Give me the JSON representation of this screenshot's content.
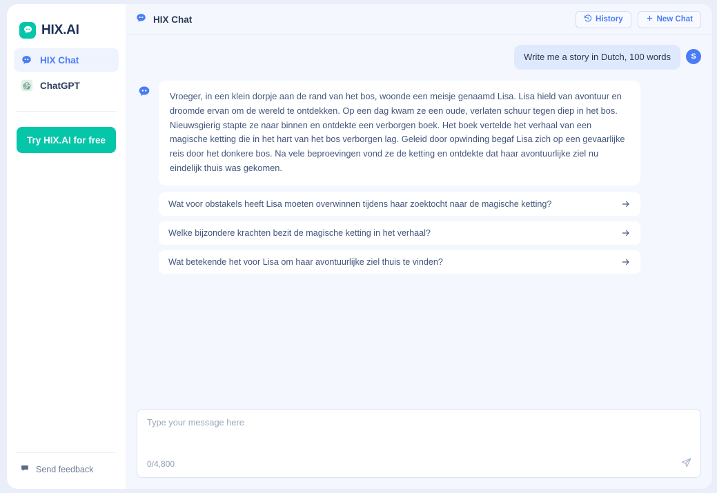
{
  "sidebar": {
    "brand": {
      "name": "HIX.AI",
      "icon": "hix-logo-icon",
      "color": "#05c6a9"
    },
    "items": [
      {
        "label": "HIX Chat",
        "icon": "hix-chat-icon",
        "active": true
      },
      {
        "label": "ChatGPT",
        "icon": "openai-icon",
        "active": false
      }
    ],
    "cta_label": "Try HIX.AI for free",
    "footer": {
      "label": "Send feedback",
      "icon": "feedback-flag-icon"
    }
  },
  "header": {
    "title": "HIX Chat",
    "icon": "hix-chat-icon",
    "history_label": "History",
    "history_icon": "clock-history-icon",
    "new_chat_label": "New Chat",
    "new_chat_icon": "plus-icon"
  },
  "conversation": {
    "user_message": "Write me a story in Dutch, 100 words",
    "user_avatar_initial": "S",
    "assistant_message": "Vroeger, in een klein dorpje aan de rand van het bos, woonde een meisje genaamd Lisa. Lisa hield van avontuur en droomde ervan om de wereld te ontdekken. Op een dag kwam ze een oude, verlaten schuur tegen diep in het bos. Nieuwsgierig stapte ze naar binnen en ontdekte een verborgen boek. Het boek vertelde het verhaal van een magische ketting die in het hart van het bos verborgen lag. Geleid door opwinding begaf Lisa zich op een gevaarlijke reis door het donkere bos. Na vele beproevingen vond ze de ketting en ontdekte dat haar avontuurlijke ziel nu eindelijk thuis was gekomen.",
    "suggestions": [
      "Wat voor obstakels heeft Lisa moeten overwinnen tijdens haar zoektocht naar de magische ketting?",
      "Welke bijzondere krachten bezit de magische ketting in het verhaal?",
      "Wat betekende het voor Lisa om haar avontuurlijke ziel thuis te vinden?"
    ]
  },
  "composer": {
    "placeholder": "Type your message here",
    "value": "",
    "counter": "0/4,800",
    "send_icon": "send-paper-plane-icon"
  },
  "colors": {
    "brand_green": "#05c6a9",
    "accent_blue": "#4a7cf6",
    "canvas": "#f4f7fd"
  }
}
